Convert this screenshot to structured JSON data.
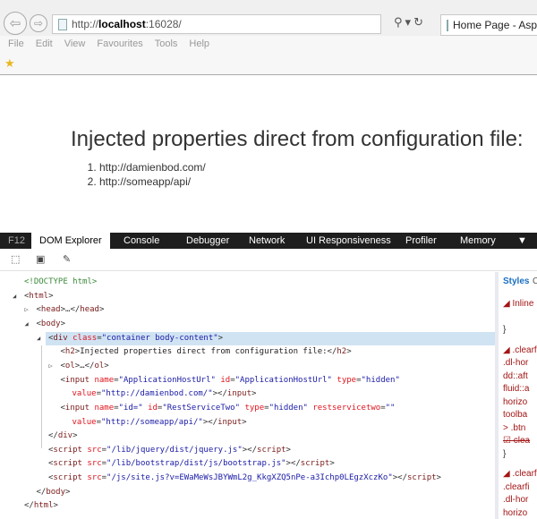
{
  "browser": {
    "url_prefix": "http://",
    "url_host": "localhost",
    "url_rest": ":16028/",
    "tab_title": "Home Page - AspNe",
    "menu": [
      "File",
      "Edit",
      "View",
      "Favourites",
      "Tools",
      "Help"
    ]
  },
  "page": {
    "heading": "Injected properties direct from configuration file:",
    "list": [
      "http://damienbod.com/",
      "http://someapp/api/"
    ]
  },
  "devtools": {
    "f12": "F12",
    "tabs": [
      "DOM Explorer",
      "Console",
      "Debugger",
      "Network",
      "UI Responsiveness",
      "Profiler",
      "Memory"
    ],
    "dom_lines": [
      {
        "indent": 0,
        "tri": "",
        "tokens": [
          [
            "doc",
            "<!DOCTYPE html>"
          ]
        ]
      },
      {
        "indent": 1,
        "tri": "open",
        "tokens": [
          [
            "p",
            "<"
          ],
          [
            "tag",
            "html"
          ],
          [
            "p",
            ">"
          ]
        ]
      },
      {
        "indent": 2,
        "tri": "closed",
        "tokens": [
          [
            "p",
            "<"
          ],
          [
            "tag",
            "head"
          ],
          [
            "p",
            ">…</"
          ],
          [
            "tag",
            "head"
          ],
          [
            "p",
            ">"
          ]
        ]
      },
      {
        "indent": 2,
        "tri": "open",
        "tokens": [
          [
            "p",
            "<"
          ],
          [
            "tag",
            "body"
          ],
          [
            "p",
            ">"
          ]
        ]
      },
      {
        "indent": 3,
        "tri": "open",
        "selected": true,
        "tokens": [
          [
            "p",
            "<"
          ],
          [
            "tag",
            "div"
          ],
          [
            "p",
            " "
          ],
          [
            "attr",
            "class"
          ],
          [
            "p",
            "="
          ],
          [
            "val",
            "\"container body-content\""
          ],
          [
            "p",
            ">"
          ]
        ]
      },
      {
        "indent": 4,
        "tri": "",
        "tokens": [
          [
            "p",
            "<"
          ],
          [
            "tag",
            "h2"
          ],
          [
            "p",
            ">"
          ],
          [
            "text",
            "Injected properties direct from configuration file:"
          ],
          [
            "p",
            "</"
          ],
          [
            "tag",
            "h2"
          ],
          [
            "p",
            ">"
          ]
        ]
      },
      {
        "indent": 4,
        "tri": "closed",
        "tokens": [
          [
            "p",
            "<"
          ],
          [
            "tag",
            "ol"
          ],
          [
            "p",
            ">…</"
          ],
          [
            "tag",
            "ol"
          ],
          [
            "p",
            ">"
          ]
        ]
      },
      {
        "indent": 4,
        "tri": "",
        "tokens": [
          [
            "p",
            "<"
          ],
          [
            "tag",
            "input"
          ],
          [
            "p",
            " "
          ],
          [
            "attr",
            "name"
          ],
          [
            "p",
            "="
          ],
          [
            "val",
            "\"ApplicationHostUrl\""
          ],
          [
            "p",
            " "
          ],
          [
            "attr",
            "id"
          ],
          [
            "p",
            "="
          ],
          [
            "val",
            "\"ApplicationHostUrl\""
          ],
          [
            "p",
            " "
          ],
          [
            "attr",
            "type"
          ],
          [
            "p",
            "="
          ],
          [
            "val",
            "\"hidden\""
          ]
        ]
      },
      {
        "indent": 4,
        "tri": "",
        "tokens": [
          [
            "attr",
            "value"
          ],
          [
            "p",
            "="
          ],
          [
            "val",
            "\"http://damienbod.com/\""
          ],
          [
            "p",
            "></"
          ],
          [
            "tag",
            "input"
          ],
          [
            "p",
            ">"
          ]
        ]
      },
      {
        "indent": 4,
        "tri": "",
        "tokens": [
          [
            "p",
            "<"
          ],
          [
            "tag",
            "input"
          ],
          [
            "p",
            " "
          ],
          [
            "attr",
            "name"
          ],
          [
            "p",
            "="
          ],
          [
            "val",
            "\"id=\""
          ],
          [
            "p",
            " "
          ],
          [
            "attr",
            "id"
          ],
          [
            "p",
            "="
          ],
          [
            "val",
            "\"RestServiceTwo\""
          ],
          [
            "p",
            " "
          ],
          [
            "attr",
            "type"
          ],
          [
            "p",
            "="
          ],
          [
            "val",
            "\"hidden\""
          ],
          [
            "p",
            " "
          ],
          [
            "attr",
            "restservicetwo"
          ],
          [
            "p",
            "="
          ],
          [
            "val",
            "\"\""
          ]
        ]
      },
      {
        "indent": 4,
        "tri": "",
        "tokens": [
          [
            "attr",
            "value"
          ],
          [
            "p",
            "="
          ],
          [
            "val",
            "\"http://someapp/api/\""
          ],
          [
            "p",
            "></"
          ],
          [
            "tag",
            "input"
          ],
          [
            "p",
            ">"
          ]
        ]
      },
      {
        "indent": 3,
        "tri": "",
        "tokens": [
          [
            "p",
            "</"
          ],
          [
            "tag",
            "div"
          ],
          [
            "p",
            ">"
          ]
        ]
      },
      {
        "indent": 3,
        "tri": "",
        "tokens": [
          [
            "p",
            "<"
          ],
          [
            "tag",
            "script"
          ],
          [
            "p",
            " "
          ],
          [
            "attr",
            "src"
          ],
          [
            "p",
            "="
          ],
          [
            "val",
            "\"/lib/jquery/dist/jquery.js\""
          ],
          [
            "p",
            "></"
          ],
          [
            "tag",
            "script"
          ],
          [
            "p",
            ">"
          ]
        ]
      },
      {
        "indent": 3,
        "tri": "",
        "tokens": [
          [
            "p",
            "<"
          ],
          [
            "tag",
            "script"
          ],
          [
            "p",
            " "
          ],
          [
            "attr",
            "src"
          ],
          [
            "p",
            "="
          ],
          [
            "val",
            "\"/lib/bootstrap/dist/js/bootstrap.js\""
          ],
          [
            "p",
            "></"
          ],
          [
            "tag",
            "script"
          ],
          [
            "p",
            ">"
          ]
        ]
      },
      {
        "indent": 3,
        "tri": "",
        "tokens": [
          [
            "p",
            "<"
          ],
          [
            "tag",
            "script"
          ],
          [
            "p",
            " "
          ],
          [
            "attr",
            "src"
          ],
          [
            "p",
            "="
          ],
          [
            "val",
            "\"/js/site.js?v=EWaMeWsJBYWmL2g_KkgXZQ5nPe-a3Ichp0LEgzXczKo\""
          ],
          [
            "p",
            "></"
          ],
          [
            "tag",
            "script"
          ],
          [
            "p",
            ">"
          ]
        ]
      },
      {
        "indent": 2,
        "tri": "",
        "tokens": [
          [
            "p",
            "</"
          ],
          [
            "tag",
            "body"
          ],
          [
            "p",
            ">"
          ]
        ]
      },
      {
        "indent": 1,
        "tri": "",
        "tokens": [
          [
            "p",
            "</"
          ],
          [
            "tag",
            "html"
          ],
          [
            "p",
            ">"
          ]
        ]
      }
    ],
    "styles": {
      "tab": "Styles",
      "tab2": "C",
      "lines": [
        "◢ Inline",
        "",
        "}",
        "◢ .clearfi",
        ".dl-hor",
        "dd::aft",
        "fluid::a",
        "horizo",
        "toolba",
        "> .btn",
        "☑ clea",
        "}",
        "◢ .clearfi",
        ".clearfi",
        ".dl-hor",
        "horizo",
        ".conta",
        ".conta"
      ]
    }
  }
}
